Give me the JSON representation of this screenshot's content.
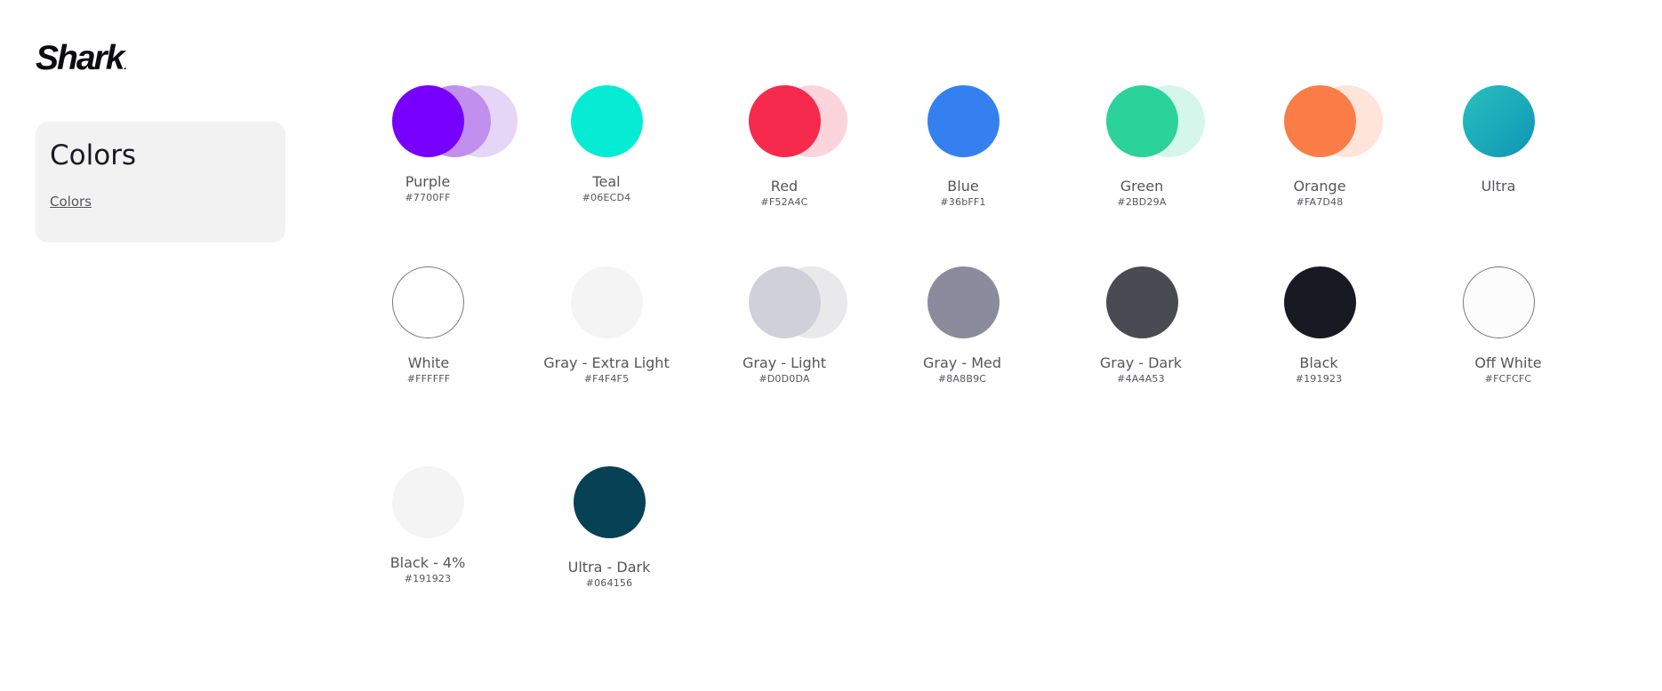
{
  "brand": {
    "name": "Shark",
    "dot": "."
  },
  "sidebar": {
    "title": "Colors",
    "link": "Colors"
  },
  "swatches": [
    {
      "label": "Purple",
      "hex": "#7700FF",
      "fill": "#7700FF",
      "tints": [
        "#C18FEE",
        "#E5D5F7"
      ]
    },
    {
      "label": "Teal",
      "hex": "#06ECD4",
      "fill": "#06ECD4",
      "tints": []
    },
    {
      "label": "Red",
      "hex": "#F52A4C",
      "fill": "#F52A4C",
      "tints": [
        "#FCD4DB"
      ]
    },
    {
      "label": "Blue",
      "hex": "#36bFF1",
      "fill": "#3580F1",
      "tints": []
    },
    {
      "label": "Green",
      "hex": "#2BD29A",
      "fill": "#2BD29A",
      "tints": [
        "#D5F6EB"
      ]
    },
    {
      "label": "Orange",
      "hex": "#FA7D48",
      "fill": "#FA7D48",
      "tints": [
        "#FEE4D9"
      ]
    },
    {
      "label": "Ultra",
      "hex": "",
      "fill": "#1AAAB8",
      "tints": []
    },
    {
      "label": "White",
      "hex": "#FFFFFF",
      "fill": "#FFFFFF",
      "border": "#7a7a80",
      "tints": []
    },
    {
      "label": "Gray - Extra Light",
      "hex": "#F4F4F5",
      "fill": "#F4F4F5",
      "tints": []
    },
    {
      "label": "Gray - Light",
      "hex": "#D0D0DA",
      "fill": "#D0D0DA",
      "tints": [
        "#E9E9EC"
      ]
    },
    {
      "label": "Gray - Med",
      "hex": "#8A8B9C",
      "fill": "#8A8B9C",
      "tints": []
    },
    {
      "label": "Gray - Dark",
      "hex": "#4A4A53",
      "fill": "#4A4A53",
      "tints": []
    },
    {
      "label": "Black",
      "hex": "#191923",
      "fill": "#191923",
      "tints": []
    },
    {
      "label": "Off White",
      "hex": "#FCFCFC",
      "fill": "#FCFCFC",
      "border": "#7a7a80",
      "tints": []
    },
    {
      "label": "Black - 4%",
      "hex": "#191923",
      "fill": "#F4F4F4",
      "tints": []
    },
    {
      "label": "Ultra - Dark",
      "hex": "#064156",
      "fill": "#064156",
      "tints": []
    }
  ]
}
